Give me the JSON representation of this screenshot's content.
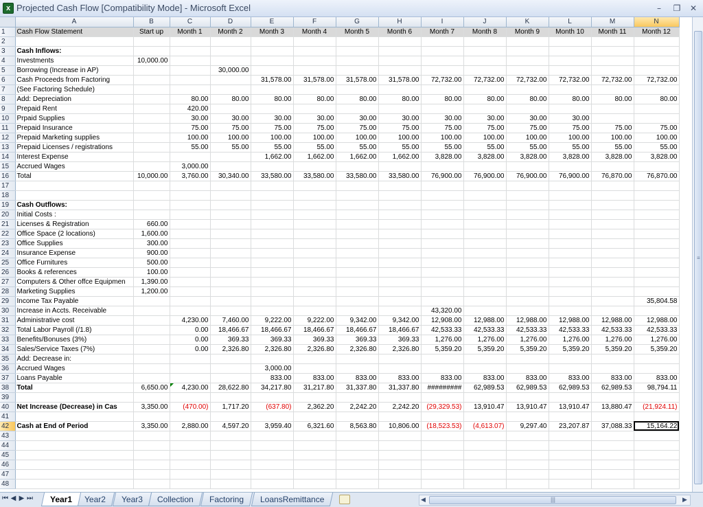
{
  "window": {
    "title": "Projected Cash Flow  [Compatibility Mode] - Microsoft Excel",
    "app_icon": "excel-icon",
    "controls": [
      "minimize-icon",
      "restore-icon",
      "close-icon"
    ]
  },
  "sheet": {
    "columns": [
      "A",
      "B",
      "C",
      "D",
      "E",
      "F",
      "G",
      "H",
      "I",
      "J",
      "K",
      "L",
      "M",
      "N"
    ],
    "active_column": "N",
    "active_row": 42,
    "rows": [
      {
        "r": 1,
        "A": "Cash Flow Statement",
        "B": "Start up",
        "C": "Month 1",
        "D": "Month 2",
        "E": "Month 3",
        "F": "Month 4",
        "G": "Month 5",
        "H": "Month 6",
        "I": "Month 7",
        "J": "Month 8",
        "K": "Month 9",
        "L": "Month 10",
        "M": "Month 11",
        "N": "Month 12"
      },
      {
        "r": 2
      },
      {
        "r": 3,
        "A": "Cash Inflows:"
      },
      {
        "r": 4,
        "A": "Investments",
        "B": "10,000.00"
      },
      {
        "r": 5,
        "A": "Borrowing (Increase in AP)",
        "D": "30,000.00"
      },
      {
        "r": 6,
        "A": "Cash Proceeds from Factoring",
        "E": "31,578.00",
        "F": "31,578.00",
        "G": "31,578.00",
        "H": "31,578.00",
        "I": "72,732.00",
        "J": "72,732.00",
        "K": "72,732.00",
        "L": "72,732.00",
        "M": "72,732.00",
        "N": "72,732.00"
      },
      {
        "r": 7,
        "A": " (See Factoring Schedule)"
      },
      {
        "r": 8,
        "A": "Add: Depreciation",
        "C": "80.00",
        "D": "80.00",
        "E": "80.00",
        "F": "80.00",
        "G": "80.00",
        "H": "80.00",
        "I": "80.00",
        "J": "80.00",
        "K": "80.00",
        "L": "80.00",
        "M": "80.00",
        "N": "80.00"
      },
      {
        "r": 9,
        "A": "        Prepaid Rent",
        "C": "420.00"
      },
      {
        "r": 10,
        "A": "        Prpaid Supplies",
        "C": "30.00",
        "D": "30.00",
        "E": "30.00",
        "F": "30.00",
        "G": "30.00",
        "H": "30.00",
        "I": "30.00",
        "J": "30.00",
        "K": "30.00",
        "L": "30.00"
      },
      {
        "r": 11,
        "A": "        Prepaid Insurance",
        "C": "75.00",
        "D": "75.00",
        "E": "75.00",
        "F": "75.00",
        "G": "75.00",
        "H": "75.00",
        "I": "75.00",
        "J": "75.00",
        "K": "75.00",
        "L": "75.00",
        "M": "75.00",
        "N": "75.00"
      },
      {
        "r": 12,
        "A": "        Prepaid Marketing supplies",
        "C": "100.00",
        "D": "100.00",
        "E": "100.00",
        "F": "100.00",
        "G": "100.00",
        "H": "100.00",
        "I": "100.00",
        "J": "100.00",
        "K": "100.00",
        "L": "100.00",
        "M": "100.00",
        "N": "100.00"
      },
      {
        "r": 13,
        "A": "         Prepaid Licenses / registrations",
        "C": "55.00",
        "D": "55.00",
        "E": "55.00",
        "F": "55.00",
        "G": "55.00",
        "H": "55.00",
        "I": "55.00",
        "J": "55.00",
        "K": "55.00",
        "L": "55.00",
        "M": "55.00",
        "N": "55.00"
      },
      {
        "r": 14,
        "A": "        Interest Expense",
        "E": "1,662.00",
        "F": "1,662.00",
        "G": "1,662.00",
        "H": "1,662.00",
        "I": "3,828.00",
        "J": "3,828.00",
        "K": "3,828.00",
        "L": "3,828.00",
        "M": "3,828.00",
        "N": "3,828.00"
      },
      {
        "r": 15,
        "A": "        Accrued Wages",
        "C": "3,000.00"
      },
      {
        "r": 16,
        "A": "Total",
        "B": "10,000.00",
        "C": "3,760.00",
        "D": "30,340.00",
        "E": "33,580.00",
        "F": "33,580.00",
        "G": "33,580.00",
        "H": "33,580.00",
        "I": "76,900.00",
        "J": "76,900.00",
        "K": "76,900.00",
        "L": "76,900.00",
        "M": "76,870.00",
        "N": "76,870.00"
      },
      {
        "r": 17
      },
      {
        "r": 18
      },
      {
        "r": 19,
        "A": "Cash Outflows:"
      },
      {
        "r": 20,
        "A": "Initial Costs :"
      },
      {
        "r": 21,
        "A": "Licenses & Registration",
        "B": "660.00"
      },
      {
        "r": 22,
        "A": "Office Space (2 locations)",
        "B": "1,600.00"
      },
      {
        "r": 23,
        "A": "Office Supplies",
        "B": "300.00"
      },
      {
        "r": 24,
        "A": "Insurance Expense",
        "B": "900.00"
      },
      {
        "r": 25,
        "A": "Office Furnitures",
        "B": "500.00"
      },
      {
        "r": 26,
        "A": "Books & references",
        "B": "100.00"
      },
      {
        "r": 27,
        "A": "Computers & Other offce Equipmen",
        "B": "1,390.00"
      },
      {
        "r": 28,
        "A": "Marketing Supplies",
        "B": "1,200.00"
      },
      {
        "r": 29,
        "A": "Income Tax Payable",
        "N": "35,804.58"
      },
      {
        "r": 30,
        "A": "Increase in Accts. Receivable",
        "I": "43,320.00"
      },
      {
        "r": 31,
        "A": "Administrative cost",
        "C": "4,230.00",
        "D": "7,460.00",
        "E": "9,222.00",
        "F": "9,222.00",
        "G": "9,342.00",
        "H": "9,342.00",
        "I": "12,908.00",
        "J": "12,988.00",
        "K": "12,988.00",
        "L": "12,988.00",
        "M": "12,988.00",
        "N": "12,988.00"
      },
      {
        "r": 32,
        "A": "Total Labor Payroll (/1.8)",
        "C": "0.00",
        "D": "18,466.67",
        "E": "18,466.67",
        "F": "18,466.67",
        "G": "18,466.67",
        "H": "18,466.67",
        "I": "42,533.33",
        "J": "42,533.33",
        "K": "42,533.33",
        "L": "42,533.33",
        "M": "42,533.33",
        "N": "42,533.33"
      },
      {
        "r": 33,
        "A": "Benefits/Bonuses (3%)",
        "C": "0.00",
        "D": "369.33",
        "E": "369.33",
        "F": "369.33",
        "G": "369.33",
        "H": "369.33",
        "I": "1,276.00",
        "J": "1,276.00",
        "K": "1,276.00",
        "L": "1,276.00",
        "M": "1,276.00",
        "N": "1,276.00"
      },
      {
        "r": 34,
        "A": "Sales/Service Taxes  (7%)",
        "C": "0.00",
        "D": "2,326.80",
        "E": "2,326.80",
        "F": "2,326.80",
        "G": "2,326.80",
        "H": "2,326.80",
        "I": "5,359.20",
        "J": "5,359.20",
        "K": "5,359.20",
        "L": "5,359.20",
        "M": "5,359.20",
        "N": "5,359.20"
      },
      {
        "r": 35,
        "A": "Add: Decrease in:"
      },
      {
        "r": 36,
        "A": "        Accrued Wages",
        "E": "3,000.00"
      },
      {
        "r": 37,
        "A": "        Loans Payable",
        "E": "833.00",
        "F": "833.00",
        "G": "833.00",
        "H": "833.00",
        "I": "833.00",
        "J": "833.00",
        "K": "833.00",
        "L": "833.00",
        "M": "833.00",
        "N": "833.00"
      },
      {
        "r": 38,
        "A": "Total",
        "B": "6,650.00",
        "C": "4,230.00",
        "D": "28,622.80",
        "E": "34,217.80",
        "F": "31,217.80",
        "G": "31,337.80",
        "H": "31,337.80",
        "I": "#########",
        "J": "62,989.53",
        "K": "62,989.53",
        "L": "62,989.53",
        "M": "62,989.53",
        "N": "98,794.11"
      },
      {
        "r": 39
      },
      {
        "r": 40,
        "A": "Net Increase (Decrease) in Cas",
        "B": "3,350.00",
        "C": "(470.00)",
        "D": "1,717.20",
        "E": "(637.80)",
        "F": "2,362.20",
        "G": "2,242.20",
        "H": "2,242.20",
        "I": "(29,329.53)",
        "J": "13,910.47",
        "K": "13,910.47",
        "L": "13,910.47",
        "M": "13,880.47",
        "N": "(21,924.11)"
      },
      {
        "r": 41
      },
      {
        "r": 42,
        "A": "Cash at End of Period",
        "B": "3,350.00",
        "C": "2,880.00",
        "D": "4,597.20",
        "E": "3,959.40",
        "F": "6,321.60",
        "G": "8,563.80",
        "H": "10,806.00",
        "I": "(18,523.53)",
        "J": "(4,613.07)",
        "K": "9,297.40",
        "L": "23,207.87",
        "M": "37,088.33",
        "N": "15,164.22"
      },
      {
        "r": 43
      },
      {
        "r": 44
      },
      {
        "r": 45
      },
      {
        "r": 46
      },
      {
        "r": 47
      },
      {
        "r": 48
      }
    ]
  },
  "tabs": [
    {
      "label": "Year1",
      "active": true
    },
    {
      "label": "Year2",
      "active": false
    },
    {
      "label": "Year3",
      "active": false
    },
    {
      "label": "Collection",
      "active": false
    },
    {
      "label": "Factoring",
      "active": false
    },
    {
      "label": "LoansRemittance",
      "active": false
    }
  ],
  "colors": {
    "negative": "#e00000",
    "header_fill": "#d9d9d9",
    "active_header": "#f9c75d"
  }
}
